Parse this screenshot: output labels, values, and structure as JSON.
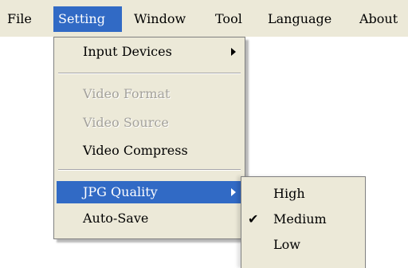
{
  "menubar": {
    "items": [
      "File",
      "Setting",
      "Window",
      "Tool",
      "Language",
      "About"
    ],
    "active": "Setting"
  },
  "setting_menu": {
    "input_devices": "Input Devices",
    "video_format": "Video Format",
    "video_source": "Video Source",
    "video_compress": "Video Compress",
    "jpg_quality": "JPG Quality",
    "auto_save": "Auto-Save"
  },
  "jpg_submenu": {
    "items": [
      "High",
      "Medium",
      "Low"
    ],
    "checked": "Medium"
  },
  "colors": {
    "menu_background": "#ece9d8",
    "highlight": "#316ac5",
    "disabled_text": "#a4a29c"
  },
  "icons": {
    "submenu_arrow": "chevron-right-icon",
    "checked": "checkmark-icon"
  }
}
